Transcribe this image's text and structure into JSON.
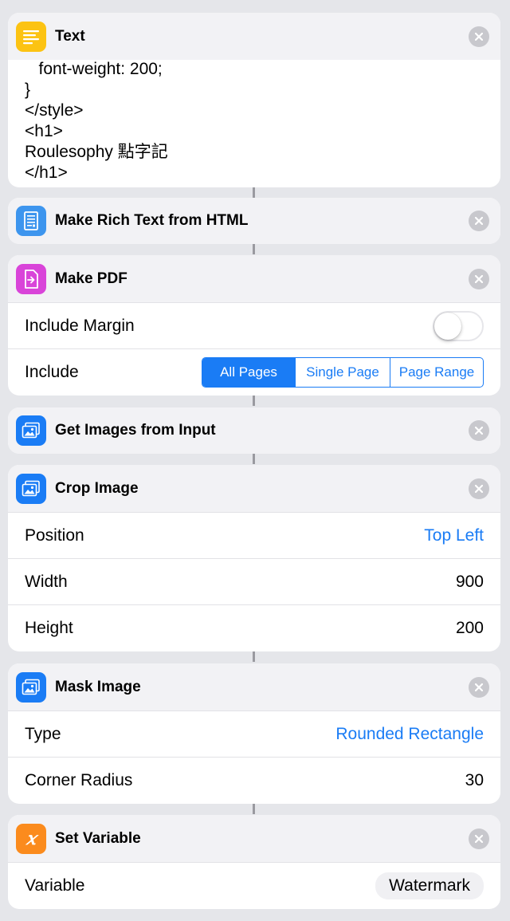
{
  "colors": {
    "background": "#e5e6ea",
    "accent_blue": "#1a7cf5",
    "text_icon_yellow": "#fcc313",
    "rich_text_icon_blue": "#3d95ee",
    "make_pdf_icon_magenta": "#d944d9",
    "image_icon_blue": "#1a7cf5",
    "variable_icon_orange": "#fb8b1d"
  },
  "actions": {
    "text": {
      "title": "Text",
      "icon": "text-lines-icon",
      "lines": [
        "   font-weight: 200;",
        "}",
        "</style>",
        "<h1>",
        "Roulesophy 點字記",
        "</h1>"
      ]
    },
    "rich_text": {
      "title": "Make Rich Text from HTML",
      "icon": "document-icon"
    },
    "make_pdf": {
      "title": "Make PDF",
      "icon": "pdf-export-icon",
      "include_margin_label": "Include Margin",
      "include_margin_on": false,
      "include_label": "Include",
      "segments": [
        "All Pages",
        "Single Page",
        "Page Range"
      ],
      "selected_segment": "All Pages"
    },
    "get_images": {
      "title": "Get Images from Input",
      "icon": "photos-icon"
    },
    "crop_image": {
      "title": "Crop Image",
      "icon": "photos-icon",
      "position_label": "Position",
      "position_value": "Top Left",
      "width_label": "Width",
      "width_value": "900",
      "height_label": "Height",
      "height_value": "200"
    },
    "mask_image": {
      "title": "Mask Image",
      "icon": "photos-icon",
      "type_label": "Type",
      "type_value": "Rounded Rectangle",
      "corner_radius_label": "Corner Radius",
      "corner_radius_value": "30"
    },
    "set_variable": {
      "title": "Set Variable",
      "icon": "variable-x-icon",
      "variable_label": "Variable",
      "variable_value": "Watermark"
    }
  }
}
